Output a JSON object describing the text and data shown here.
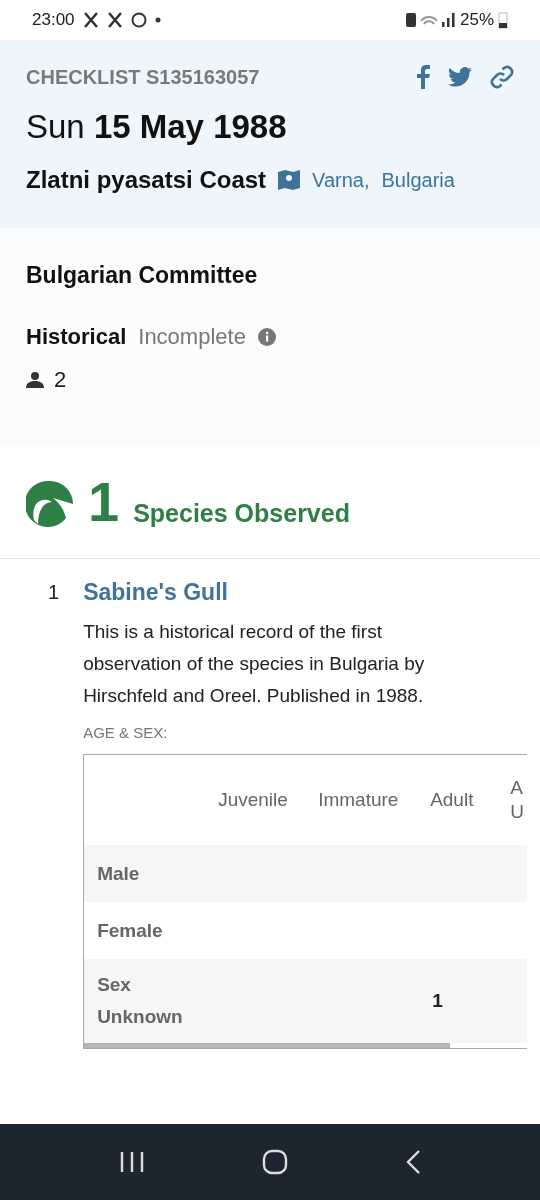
{
  "status_bar": {
    "time": "23:00",
    "battery": "25%"
  },
  "header": {
    "checklist_id": "CHECKLIST S135163057",
    "weekday": "Sun",
    "date": "15 May 1988",
    "location": "Zlatni pyasatsi Coast",
    "region": "Varna,",
    "country": "Bulgaria"
  },
  "details": {
    "observer": "Bulgarian Committee",
    "protocol": "Historical",
    "completeness": "Incomplete",
    "party_size": "2"
  },
  "summary": {
    "count": "1",
    "label": "Species Observed"
  },
  "species": [
    {
      "number": "1",
      "name": "Sabine's Gull",
      "comment": "This is a historical record of the first observation of the species in Bulgaria by Hirschfeld and Oreel. Published in 1988.",
      "age_sex_label": "AGE & SEX:",
      "table": {
        "columns": [
          "Juvenile",
          "Immature",
          "Adult",
          "A U"
        ],
        "rows": [
          {
            "label": "Male",
            "cells": [
              "",
              "",
              "",
              ""
            ]
          },
          {
            "label": "Female",
            "cells": [
              "",
              "",
              "",
              ""
            ]
          },
          {
            "label": "Sex Unknown",
            "cells": [
              "",
              "",
              "1",
              ""
            ]
          }
        ]
      }
    }
  ]
}
